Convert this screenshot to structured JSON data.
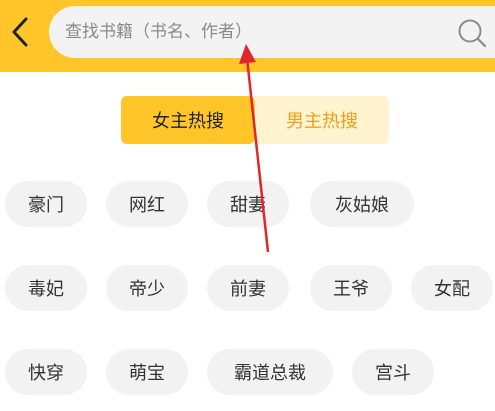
{
  "header": {
    "search_placeholder": "查找书籍（书名、作者）"
  },
  "tabs": {
    "female_label": "女主热搜",
    "male_label": "男主热搜"
  },
  "tags": {
    "row1": [
      "豪门",
      "网红",
      "甜妻",
      "灰姑娘"
    ],
    "row2": [
      "毒妃",
      "帝少",
      "前妻",
      "王爷",
      "女配"
    ],
    "row3": [
      "快穿",
      "萌宝",
      "霸道总裁",
      "宫斗"
    ]
  },
  "colors": {
    "accent": "#FFC529",
    "male_tab_bg": "#FFF3D0",
    "male_tab_text": "#F0A018",
    "tag_bg": "#F2F2F2",
    "annotation_arrow": "#E0262B"
  },
  "icons": {
    "back": "back-arrow-icon",
    "search": "search-icon"
  }
}
